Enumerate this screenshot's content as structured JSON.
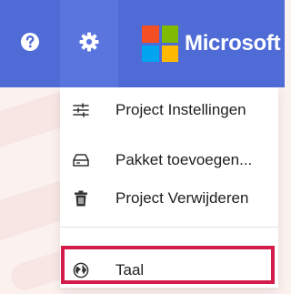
{
  "colors": {
    "topbar_bg": "#4f6bd6",
    "settings_active_bg": "#5a76de",
    "highlight_border": "#d41c4c",
    "ms_red": "#f25022",
    "ms_green": "#7fba00",
    "ms_blue": "#00a4ef",
    "ms_yellow": "#ffb900"
  },
  "topbar": {
    "help_icon": "question-circle-icon",
    "settings_icon": "gear-icon",
    "brand_text": "Microsoft"
  },
  "menu": {
    "items": [
      {
        "label": "Project Instellingen",
        "icon": "sliders-icon"
      },
      {
        "label": "Pakket toevoegen...",
        "icon": "drive-icon"
      },
      {
        "label": "Project Verwijderen",
        "icon": "trash-icon"
      },
      {
        "label": "Taal",
        "icon": "globe-icon",
        "highlighted": true
      }
    ]
  }
}
